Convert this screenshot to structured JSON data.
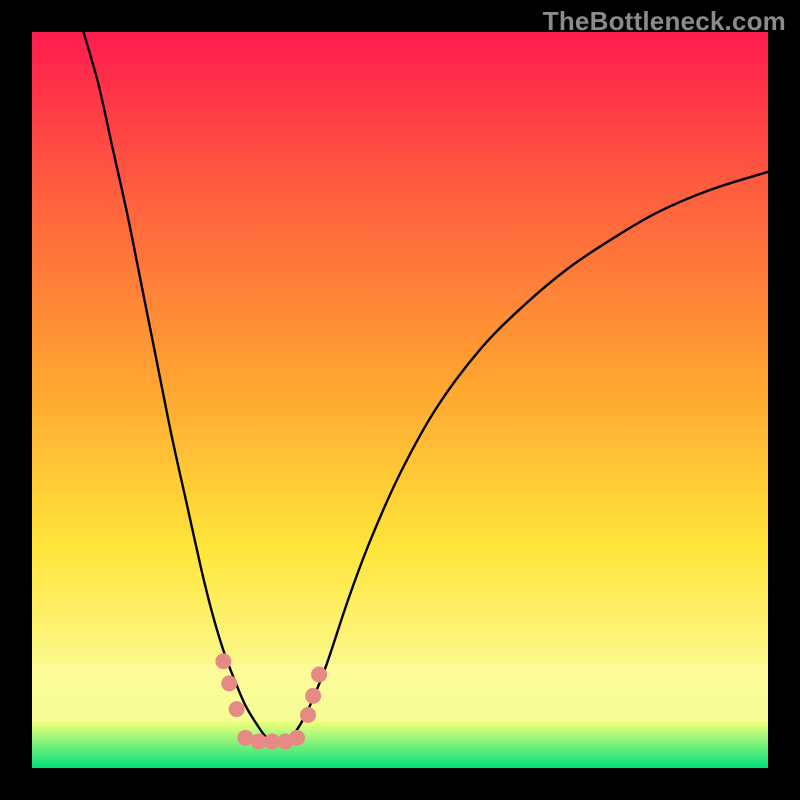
{
  "watermark": "TheBottleneck.com",
  "chart_data": {
    "type": "line",
    "title": "",
    "xlabel": "",
    "ylabel": "",
    "xlim": [
      0,
      100
    ],
    "ylim": [
      0,
      100
    ],
    "background_gradient": {
      "top": "#ff1c4f",
      "mid_top": "#ff5f3f",
      "mid": "#ffa531",
      "mid_bottom": "#ffe53a",
      "lower": "#fcf98b",
      "base_band": "#e6ff7b",
      "base": "#00e07a"
    },
    "series": [
      {
        "name": "bottleneck-curve",
        "color": "#000000",
        "x": [
          7,
          9,
          11,
          13,
          15,
          17,
          19,
          21,
          23,
          24.5,
          26,
          27.5,
          29,
          30.5,
          32,
          33.5,
          35,
          36.5,
          38,
          40,
          43,
          46,
          50,
          55,
          61,
          67,
          73,
          79,
          85,
          92,
          100
        ],
        "y": [
          100,
          93,
          84,
          75,
          65,
          55,
          45,
          36,
          27,
          21,
          16,
          12,
          8.5,
          6,
          4,
          3.5,
          4,
          6,
          9,
          14,
          23,
          31,
          40,
          49,
          57,
          63,
          68,
          72,
          75.5,
          78.5,
          81
        ]
      }
    ],
    "markers": {
      "name": "highlight-dots",
      "color": "#e58a84",
      "radius": 8,
      "points": [
        {
          "x": 26.0,
          "y": 14.5
        },
        {
          "x": 26.8,
          "y": 11.5
        },
        {
          "x": 27.8,
          "y": 8.0
        },
        {
          "x": 29.0,
          "y": 4.1
        },
        {
          "x": 30.8,
          "y": 3.6
        },
        {
          "x": 32.6,
          "y": 3.6
        },
        {
          "x": 34.4,
          "y": 3.6
        },
        {
          "x": 36.0,
          "y": 4.1
        },
        {
          "x": 37.5,
          "y": 7.2
        },
        {
          "x": 38.2,
          "y": 9.8
        },
        {
          "x": 39.0,
          "y": 12.7
        }
      ]
    }
  }
}
